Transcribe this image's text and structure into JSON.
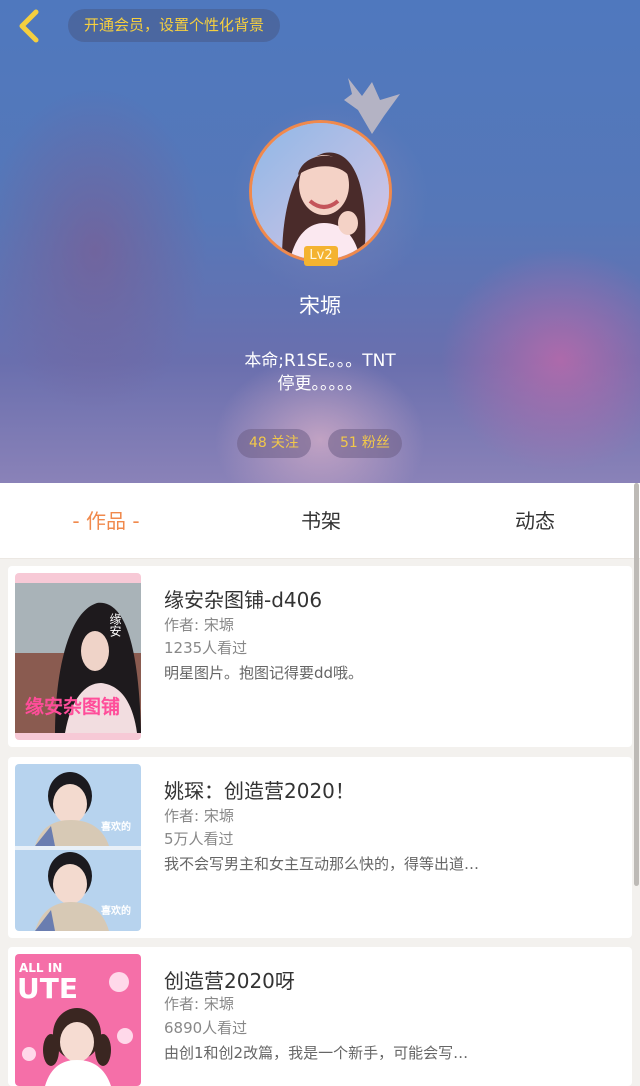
{
  "header": {
    "vip_banner": "开通会员，设置个性化背景",
    "level": "Lv2",
    "username": "宋塬",
    "bio_line1": "本命;R1SE。。。TNT",
    "bio_line2": "停更。。。。。",
    "follow_count": "48",
    "follow_label": "关注",
    "fans_count": "51",
    "fans_label": "粉丝"
  },
  "tabs": [
    {
      "label": "-  作品  -",
      "active": true
    },
    {
      "label": "书架",
      "active": false
    },
    {
      "label": "动态",
      "active": false
    }
  ],
  "works": [
    {
      "title": "缘安杂图铺-d406",
      "author": "作者: 宋塬",
      "views": "1235人看过",
      "desc": "明星图片。抱图记得要dd哦。",
      "cover_text": "缘安杂图铺",
      "cover_side_text": "缘安"
    },
    {
      "title": "姚琛：创造营2020！",
      "author": "作者: 宋塬",
      "views": "5万人看过",
      "desc": "我不会写男主和女主互动那么快的，得等出道…",
      "cover_tag": "喜欢的"
    },
    {
      "title": "创造营2020呀",
      "author": "作者: 宋塬",
      "views": "6890人看过",
      "desc": "由创1和创2改篇，我是一个新手，可能会写…",
      "cover_text_top": "ALL IN",
      "cover_text_big": "UTE"
    }
  ],
  "colors": {
    "accent": "#f0894c",
    "gold": "#f5cf3f",
    "tab_text": "#333333"
  }
}
